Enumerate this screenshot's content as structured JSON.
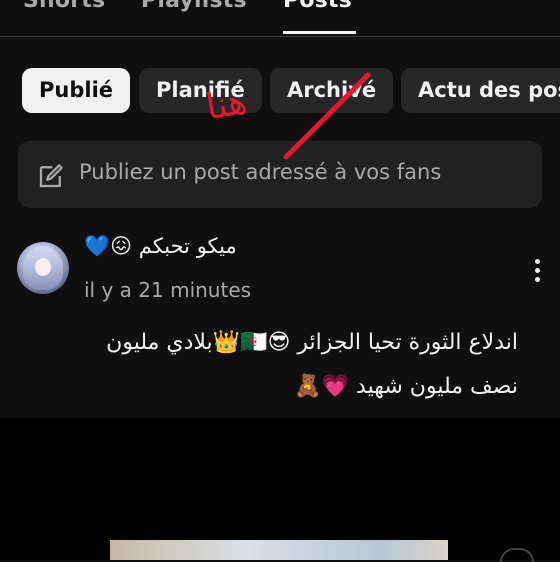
{
  "tabs": [
    {
      "label": "Shorts"
    },
    {
      "label": "Playlists"
    },
    {
      "label": "Posts"
    }
  ],
  "chips": [
    {
      "label": "Publié"
    },
    {
      "label": "Planifié"
    },
    {
      "label": "Archivé"
    },
    {
      "label": "Actu des pos"
    }
  ],
  "composer": {
    "placeholder": "Publiez un post adressé à vos fans"
  },
  "annotation": {
    "text": "هنا",
    "color": "#e5172c"
  },
  "post": {
    "author": "ميكو تحبكم 😖💙",
    "time": "il y a 21 minutes",
    "line1": "اندلاع الثورة تحيا الجزائر 😎🇩🇿👑بلادي مليون",
    "line2": "نصف مليون شهيد 💗🧸"
  },
  "colors": {
    "background": "#0f0f0f",
    "chip_bg": "#272727",
    "chip_selected_bg": "#f1f1f1",
    "composer_bg": "#212121",
    "secondary_text": "#aaaaaa"
  },
  "icons": {
    "composer": "edit-icon",
    "post_menu": "more-vert-icon"
  }
}
